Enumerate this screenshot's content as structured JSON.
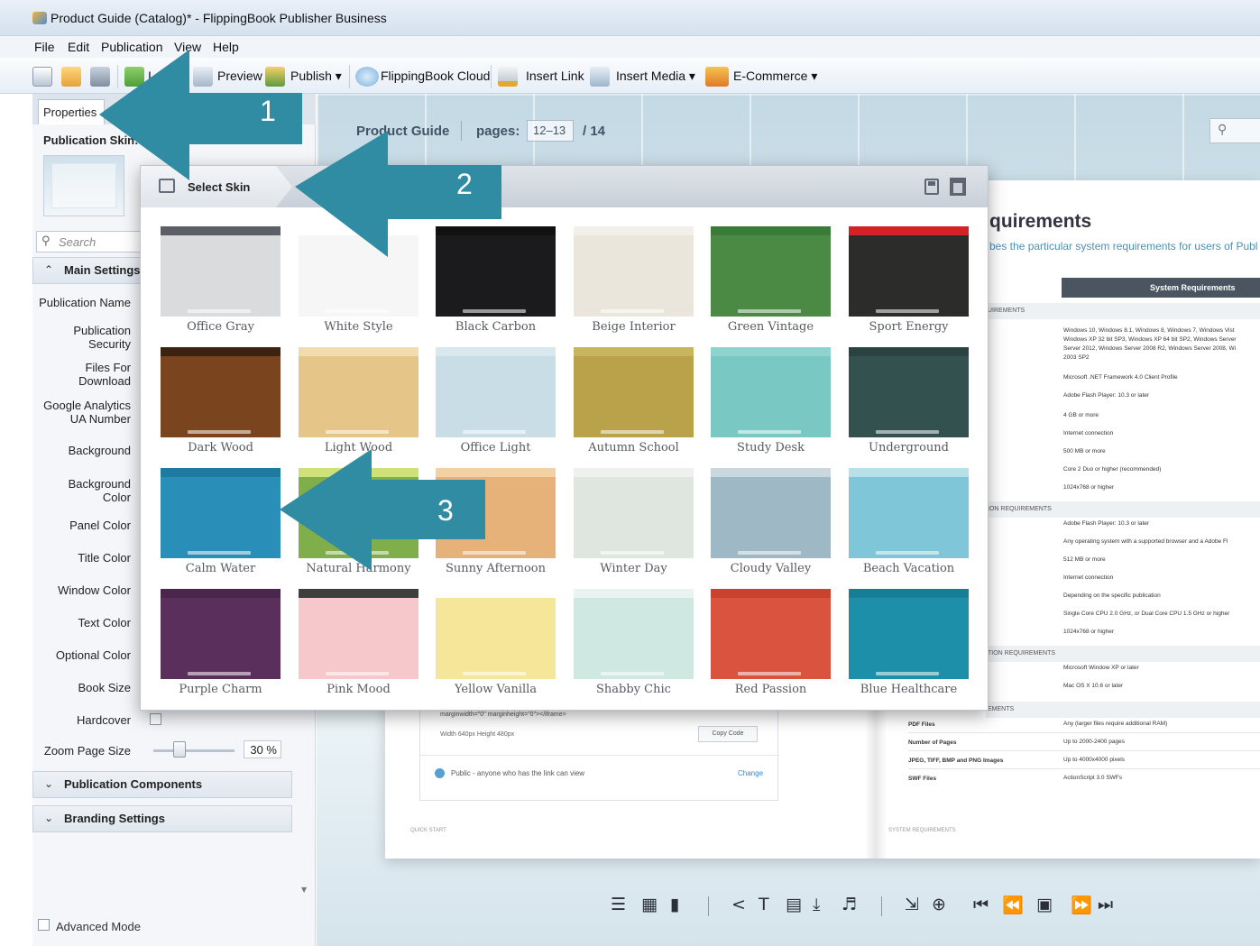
{
  "window": {
    "title": "Product Guide (Catalog)* - FlippingBook Publisher Business"
  },
  "menu": [
    "File",
    "Edit",
    "Publication",
    "View",
    "Help"
  ],
  "toolbar": {
    "import_label": "I",
    "preview_label": "Preview",
    "publish_label": "Publish ▾",
    "cloud_label": "FlippingBook Cloud",
    "insert_link_label": "Insert Link",
    "insert_media_label": "Insert Media ▾",
    "ecommerce_label": "E-Commerce ▾"
  },
  "left_panel": {
    "tab_label": "Properties",
    "skin_label": "Publication Skin:",
    "search_placeholder": "Search",
    "main_settings_label": "Main Settings",
    "properties": [
      "Publication Name",
      "Publication\nSecurity",
      "Files For\nDownload",
      "Google Analytics\nUA Number",
      "Background",
      "Background\nColor",
      "Panel Color",
      "Title Color",
      "Window Color",
      "Text Color",
      "Optional Color",
      "Book Size",
      "Hardcover",
      "Zoom Page Size"
    ],
    "zoom_value": "30 %",
    "components_label": "Publication Components",
    "branding_label": "Branding Settings",
    "advanced_mode_label": "Advanced Mode"
  },
  "preview": {
    "title": "Product Guide",
    "pages_label": "pages:",
    "pages_value": "12–13",
    "total_label": "/ 14",
    "requirements_title": "quirements",
    "requirements_subtitle": "bes the particular system requirements for users of Publ",
    "table_header": "System Requirements",
    "sections": [
      "UIREMENTS",
      "ION REQUIREMENTS",
      "TION REQUIREMENTS",
      "EMENTS"
    ],
    "req_rows": [
      "Windows 10, Windows 8.1, Windows 8, Windows 7, Windows Vist",
      "Windows XP 32 bit SP3, Windows XP 64 bit SP2, Windows Server",
      "Server 2012, Windows Server 2008 R2, Windows Server 2008, Wi",
      "2003 SP2",
      "Microsoft .NET Framework 4.0 Client Profile",
      "Adobe Flash Player: 10.3 or later",
      "4 GB or more",
      "Internet connection",
      "500 MB or more",
      "Core 2 Duo or higher (recommended)",
      "1024x768 or higher",
      "Adobe Flash Player: 10.3 or later",
      "Any operating system with a supported browser and a Adobe Fl",
      "512 MB or more",
      "Internet connection",
      "Depending on the specific publication",
      "Single Core CPU 2.0 GHz, or Dual Core CPU 1.5 GHz or higher",
      "1024x768 or higher",
      "Microsoft Window XP or later",
      "Mac OS X 10.6 or later",
      "Any (larger files require additional RAM)",
      "Up to 2000-2400 pages",
      "Up to 4000x4000 pixels",
      "ActionScript 3.0 SWFs"
    ],
    "file_keys": [
      "PDF Files",
      "Number of Pages",
      "JPEG, TIFF, BMP and PNG Images",
      "SWF Files"
    ],
    "embed_code": "marginwidth=\"0\" marginheight=\"0\"></iframe>",
    "embed_dims": "Width  640px      Height  480px",
    "copy_code_label": "Copy Code",
    "public_text": "Public - anyone who has the link can view",
    "change_label": "Change",
    "footer_left": "QUICK START",
    "footer_right": "SYSTEM REQUIREMENTS"
  },
  "popup": {
    "title": "Select Skin",
    "skins": [
      {
        "name": "Office Gray",
        "bg": "#d9dbdd",
        "bar": "#5c6066"
      },
      {
        "name": "White Style",
        "bg": "#f6f6f6",
        "bar": "#ffffff"
      },
      {
        "name": "Black Carbon",
        "bg": "#1b1b1d",
        "bar": "#111111"
      },
      {
        "name": "Beige Interior",
        "bg": "#ebe6dc",
        "bar": "#f2f0ea"
      },
      {
        "name": "Green Vintage",
        "bg": "#4a8a45",
        "bar": "#3b7a38"
      },
      {
        "name": "Sport Energy",
        "bg": "#2c2d2b",
        "bar": "#d3222a"
      },
      {
        "name": "Dark Wood",
        "bg": "#7a451e",
        "bar": "#3b2211"
      },
      {
        "name": "Light Wood",
        "bg": "#e6c688",
        "bar": "#f1dcae"
      },
      {
        "name": "Office Light",
        "bg": "#c9dde6",
        "bar": "#d9e8ef"
      },
      {
        "name": "Autumn School",
        "bg": "#b9a24a",
        "bar": "#c8b560"
      },
      {
        "name": "Study Desk",
        "bg": "#79c8c3",
        "bar": "#8fd3cf"
      },
      {
        "name": "Underground",
        "bg": "#33514e",
        "bar": "#2a4240"
      },
      {
        "name": "Calm Water",
        "bg": "#2a8fb8",
        "bar": "#1f7aa0"
      },
      {
        "name": "Natural Harmony",
        "bg": "#7fae4a",
        "bar": "#cfe27a"
      },
      {
        "name": "Sunny Afternoon",
        "bg": "#e6b27a",
        "bar": "#f2d2a4"
      },
      {
        "name": "Winter Day",
        "bg": "#dfe6e0",
        "bar": "#eef1ee"
      },
      {
        "name": "Cloudy Valley",
        "bg": "#9fb8c6",
        "bar": "#c9d7df"
      },
      {
        "name": "Beach Vacation",
        "bg": "#7fc6d8",
        "bar": "#b7e0e9"
      },
      {
        "name": "Purple Charm",
        "bg": "#5b2f5c",
        "bar": "#4b264c"
      },
      {
        "name": "Pink Mood",
        "bg": "#f6c8cc",
        "bar": "#3e3e3e"
      },
      {
        "name": "Yellow Vanilla",
        "bg": "#f6e69a",
        "bar": "#ffffff"
      },
      {
        "name": "Shabby Chic",
        "bg": "#cfe8e2",
        "bar": "#e9f3f0"
      },
      {
        "name": "Red Passion",
        "bg": "#d9533f",
        "bar": "#c9432f"
      },
      {
        "name": "Blue Healthcare",
        "bg": "#1e8fa8",
        "bar": "#167f97"
      }
    ]
  },
  "annotations": {
    "arrow1": "1",
    "arrow2": "2",
    "arrow3": "3",
    "color": "#2f8ca3"
  }
}
